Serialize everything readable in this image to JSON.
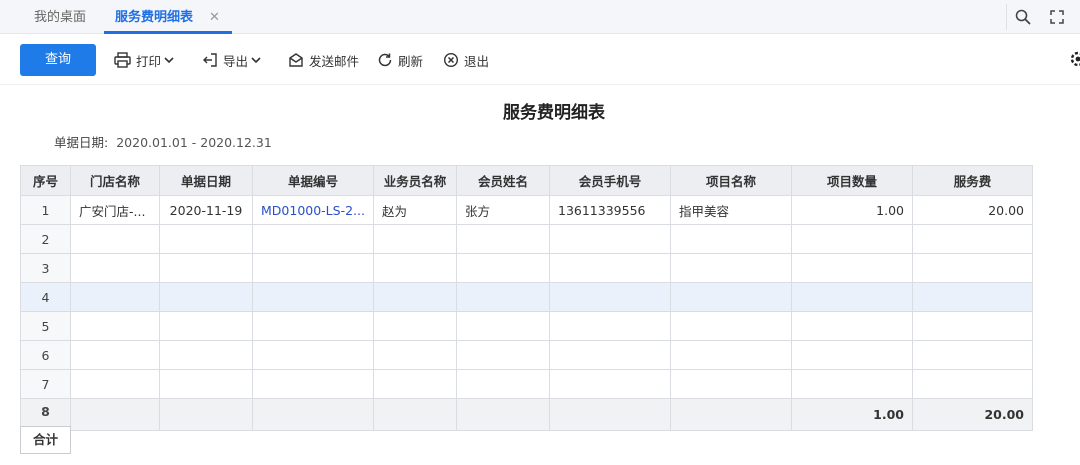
{
  "tabs": {
    "desktop": "我的桌面",
    "active": "服务费明细表",
    "close": "✕"
  },
  "toolbar": {
    "query": "查询",
    "print": "打印",
    "export": "导出",
    "mail": "发送邮件",
    "refresh": "刷新",
    "exit": "退出"
  },
  "report": {
    "title": "服务费明细表",
    "date_label": "单据日期:",
    "date_value": "2020.01.01 - 2020.12.31"
  },
  "table": {
    "headers": [
      "序号",
      "门店名称",
      "单据日期",
      "单据编号",
      "业务员名称",
      "会员姓名",
      "会员手机号",
      "项目名称",
      "项目数量",
      "服务费"
    ],
    "row1": {
      "seq": "1",
      "store": "广安门店-...",
      "date": "2020-11-19",
      "doc_no": "MD01000-LS-2...",
      "salesperson": "赵为",
      "member": "张方",
      "phone": "13611339556",
      "item": "指甲美容",
      "qty": "1.00",
      "fee": "20.00"
    },
    "empty_rows": [
      "2",
      "3",
      "4",
      "5",
      "6",
      "7",
      "8"
    ],
    "total": {
      "label": "合计",
      "qty": "1.00",
      "fee": "20.00"
    }
  },
  "colors": {
    "accent": "#1f7be8",
    "link": "#2850c8",
    "selected_row": "#eaf1fb"
  }
}
